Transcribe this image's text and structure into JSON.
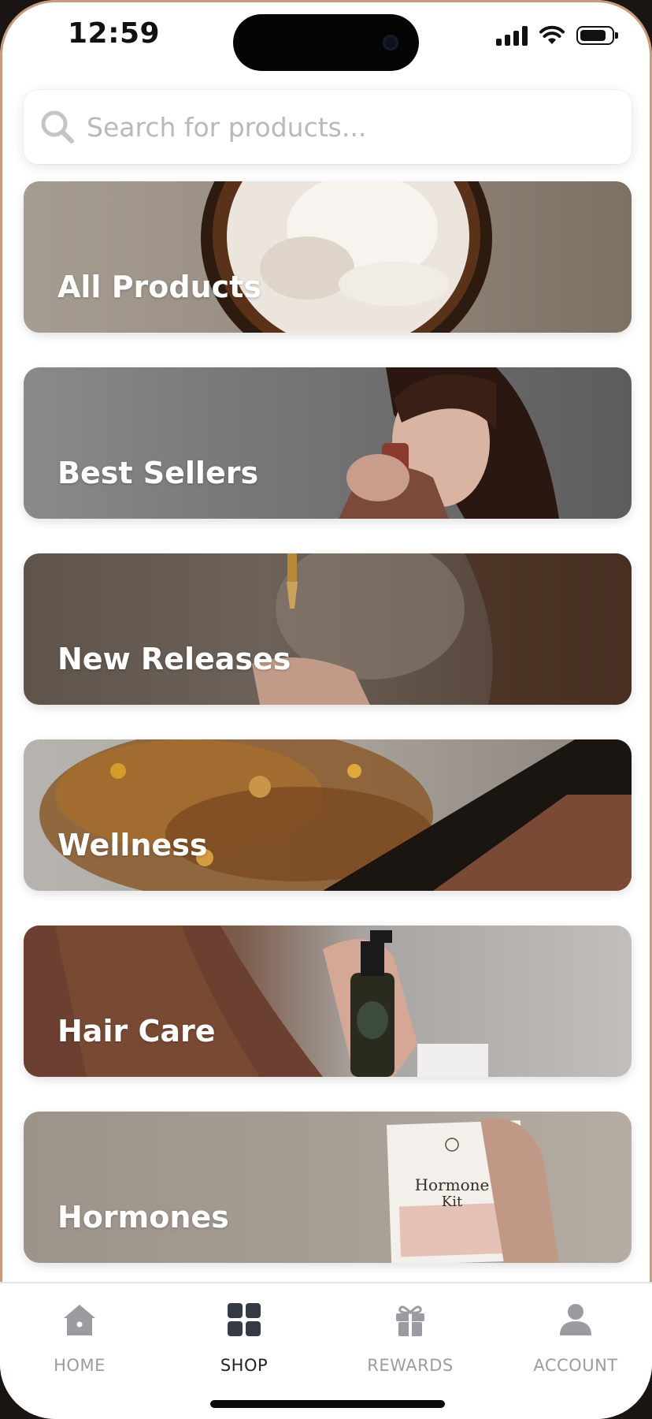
{
  "status_bar": {
    "time": "12:59"
  },
  "search": {
    "placeholder": "Search for products..."
  },
  "categories": [
    {
      "label": "All Products"
    },
    {
      "label": "Best Sellers"
    },
    {
      "label": "New Releases"
    },
    {
      "label": "Wellness"
    },
    {
      "label": "Hair Care"
    },
    {
      "label": "Hormones"
    }
  ],
  "tab_bar": {
    "items": [
      {
        "label": "HOME",
        "icon": "home-icon"
      },
      {
        "label": "SHOP",
        "icon": "shop-grid-icon",
        "active": true
      },
      {
        "label": "REWARDS",
        "icon": "gift-icon"
      },
      {
        "label": "ACCOUNT",
        "icon": "account-icon"
      }
    ]
  },
  "colors": {
    "inactive_tab": "#9a9ca2",
    "active_tab": "#1f2328",
    "card_text": "#ffffff"
  }
}
